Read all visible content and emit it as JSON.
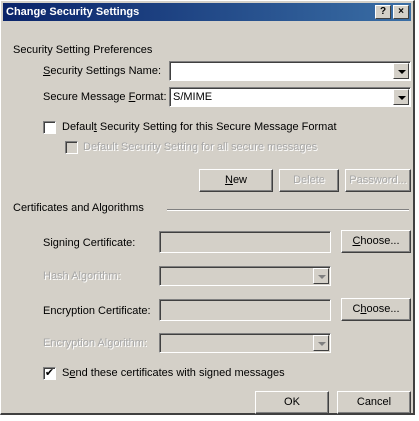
{
  "window": {
    "title": "Change Security Settings",
    "help_glyph": "?",
    "close_glyph": "×"
  },
  "preferences": {
    "group_title": "Security Setting Preferences",
    "name_label": "Security Settings Name:",
    "name_value": "",
    "format_label": "Secure Message Format:",
    "format_value": "S/MIME",
    "default_format_label": "Default Security Setting for this Secure Message Format",
    "default_format_checked": false,
    "default_all_label": "Default Security Setting for all secure messages",
    "default_all_checked": false,
    "new_button": "New",
    "delete_button": "Delete",
    "password_button": "Password..."
  },
  "certificates": {
    "group_title": "Certificates and Algorithms",
    "signing_label": "Signing Certificate:",
    "signing_value": "",
    "signing_choose": "Choose...",
    "hash_label": "Hash Algorithm:",
    "hash_value": "",
    "encryption_label": "Encryption Certificate:",
    "encryption_value": "",
    "encryption_choose": "Choose...",
    "enc_algo_label": "Encryption Algorithm:",
    "enc_algo_value": "",
    "send_certs_label": "Send these certificates with signed messages",
    "send_certs_checked": true
  },
  "footer": {
    "ok_button": "OK",
    "cancel_button": "Cancel"
  }
}
